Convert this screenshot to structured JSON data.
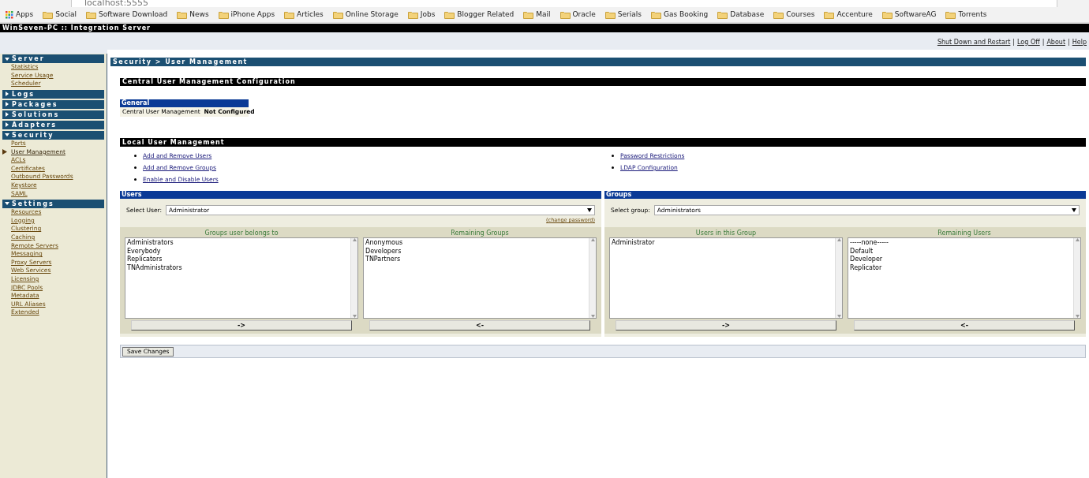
{
  "browser": {
    "address": "localhost:5555",
    "bookmarks": [
      "Apps",
      "Social",
      "Software Download",
      "News",
      "iPhone Apps",
      "Articles",
      "Online Storage",
      "Jobs",
      "Blogger Related",
      "Mail",
      "Oracle",
      "Serials",
      "Gas Booking",
      "Database",
      "Courses",
      "Accenture",
      "SoftwareAG",
      "Torrents"
    ]
  },
  "window": {
    "title": "WinSeven-PC :: Integration Server"
  },
  "top_links": [
    {
      "kind": "link",
      "text": "Shut Down and Restart"
    },
    {
      "kind": "separator",
      "text": "|"
    },
    {
      "kind": "link",
      "text": "Log Off"
    },
    {
      "kind": "separator",
      "text": "|"
    },
    {
      "kind": "link",
      "text": "About"
    },
    {
      "kind": "separator",
      "text": "|"
    },
    {
      "kind": "link",
      "text": "Help"
    }
  ],
  "sidebar": [
    {
      "label": "Server",
      "expanded": true,
      "items": [
        {
          "label": "Statistics",
          "selected": false
        },
        {
          "label": "Service Usage",
          "selected": false
        },
        {
          "label": "Scheduler",
          "selected": false
        }
      ]
    },
    {
      "label": "Logs",
      "expanded": false
    },
    {
      "label": "Packages",
      "expanded": false
    },
    {
      "label": "Solutions",
      "expanded": false
    },
    {
      "label": "Adapters",
      "expanded": false
    },
    {
      "label": "Security",
      "expanded": true,
      "items": [
        {
          "label": "Ports",
          "selected": false
        },
        {
          "label": "User Management",
          "selected": true
        },
        {
          "label": "ACLs",
          "selected": false
        },
        {
          "label": "Certificates",
          "selected": false
        },
        {
          "label": "Outbound Passwords",
          "selected": false
        },
        {
          "label": "Keystore",
          "selected": false
        },
        {
          "label": "SAML",
          "selected": false
        }
      ]
    },
    {
      "label": "Settings",
      "expanded": true,
      "items": [
        {
          "label": "Resources",
          "selected": false
        },
        {
          "label": "Logging",
          "selected": false
        },
        {
          "label": "Clustering",
          "selected": false
        },
        {
          "label": "Caching",
          "selected": false
        },
        {
          "label": "Remote Servers",
          "selected": false
        },
        {
          "label": "Messaging",
          "selected": false
        },
        {
          "label": "Proxy Servers",
          "selected": false
        },
        {
          "label": "Web Services",
          "selected": false
        },
        {
          "label": "Licensing",
          "selected": false
        },
        {
          "label": "JDBC Pools",
          "selected": false
        },
        {
          "label": "Metadata",
          "selected": false
        },
        {
          "label": "URL Aliases",
          "selected": false
        },
        {
          "label": "Extended",
          "selected": false
        }
      ]
    }
  ],
  "breadcrumb": "Security > User Management",
  "central": {
    "title": "Central User Management Configuration",
    "general_title": "General",
    "label": "Central User Management",
    "value": "Not Configured"
  },
  "local": {
    "title": "Local User Management",
    "links_left": [
      "Add and Remove Users",
      "Add and Remove Groups",
      "Enable and Disable Users"
    ],
    "links_right": [
      "Password Restrictions",
      "LDAP Configuration"
    ]
  },
  "panels": [
    {
      "title": "Users",
      "select_label": "Select User:",
      "select_value": "Administrator",
      "extra_link": "(change password)",
      "lists": [
        {
          "title": "Groups user belongs to",
          "items": [
            "Administrators",
            "Everybody",
            "Replicators",
            "TNAdministrators"
          ],
          "button": "->"
        },
        {
          "title": "Remaining Groups",
          "items": [
            "Anonymous",
            "Developers",
            "TNPartners"
          ],
          "button": "<-"
        }
      ]
    },
    {
      "title": "Groups",
      "select_label": "Select group:",
      "select_value": "Administrators",
      "lists": [
        {
          "title": "Users in this Group",
          "items": [
            "Administrator"
          ],
          "button": "->"
        },
        {
          "title": "Remaining Users",
          "items": [
            "-----none-----",
            "Default",
            "Developer",
            "Replicator"
          ],
          "button": "<-"
        }
      ]
    }
  ],
  "save_button": "Save Changes"
}
